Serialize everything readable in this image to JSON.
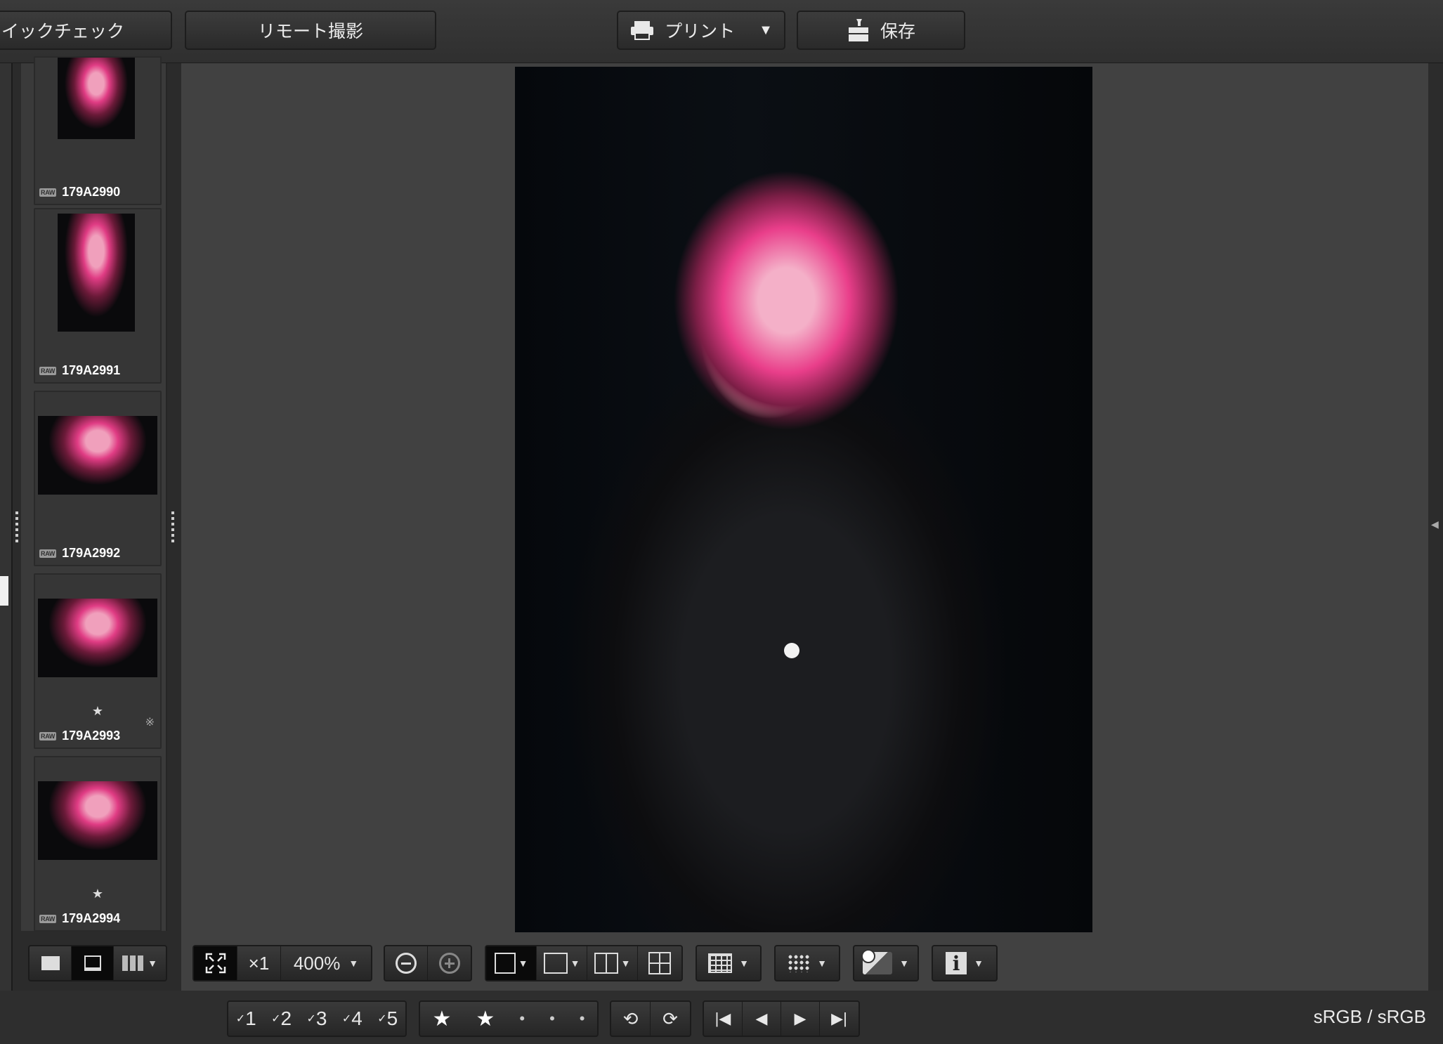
{
  "toolbar": {
    "quick_check_label": "イックチェック",
    "remote_shoot_label": "リモート撮影",
    "print_label": "プリント",
    "save_label": "保存"
  },
  "filmstrip": {
    "items": [
      {
        "name": "179A2990",
        "badge": "RAW",
        "rating": ""
      },
      {
        "name": "179A2991",
        "badge": "RAW",
        "rating": ""
      },
      {
        "name": "179A2992",
        "badge": "RAW",
        "rating": ""
      },
      {
        "name": "179A2993",
        "badge": "RAW",
        "rating": "★"
      },
      {
        "name": "179A2994",
        "badge": "RAW",
        "rating": "★"
      }
    ]
  },
  "viewer_controls": {
    "actual_size_label": "×1",
    "zoom_value": "400%"
  },
  "check_marks": [
    "1",
    "2",
    "3",
    "4",
    "5"
  ],
  "rating_symbols": {
    "star": "★",
    "dot": "•"
  },
  "status": {
    "color_space": "sRGB / sRGB"
  },
  "icons": {
    "print": "printer-icon",
    "save": "save-icon",
    "fit": "fit-screen-icon",
    "zoom_out": "zoom-out-icon",
    "zoom_in": "zoom-in-icon",
    "grid": "grid-overlay-icon",
    "af_points": "af-points-icon",
    "highlight_warning": "highlight-warning-icon",
    "info": "info-icon"
  },
  "colors": {
    "accent_pink": "#e23c86",
    "background": "#414141"
  }
}
